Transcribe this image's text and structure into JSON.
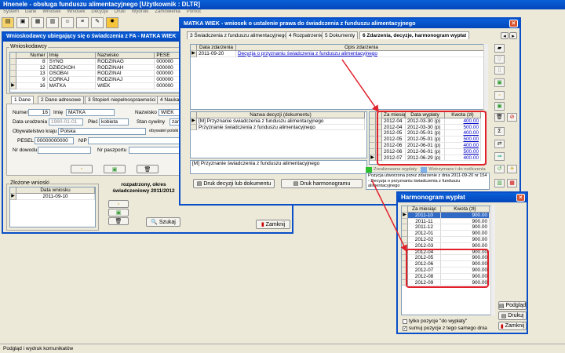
{
  "app": {
    "title": "Hnenele - obsługa funduszu alimentacyjnego [Użytkownik : DLTR]",
    "menu": [
      "System",
      "Dane",
      "Wniosek",
      "Wniosek",
      "Decyzje",
      "Druki",
      "Wydruki",
      "Zamówienia",
      "Pomoc"
    ],
    "statusbar": "Podgląd i wydruk komunikatów"
  },
  "mainwin": {
    "title": "Wnioskodawcy ubiegający się o świadczenia z FA - MATKA WIEK",
    "group_label": "Wnioskodawcy",
    "columns": [
      "Numer",
      "Imię",
      "Nazwisko",
      "PESE"
    ],
    "rows": [
      [
        "8",
        "SYNG",
        "RODZINAG",
        "000000"
      ],
      [
        "12",
        "DZIECKOH",
        "RODZINAH",
        "000000"
      ],
      [
        "13",
        "OSOBAI",
        "RODZINAI",
        "000000"
      ],
      [
        "9",
        "CORKAJ",
        "RODZINAJ",
        "000000"
      ],
      [
        "16",
        "MATKA",
        "WIEK",
        "000000"
      ]
    ],
    "tabs": [
      "1 Dane",
      "2 Dane adresowe",
      "3 Stopień niepełnosprawności",
      "4 Nauka"
    ],
    "fields": {
      "numer_label": "Numer",
      "numer": "16",
      "imie_label": "Imię",
      "imie": "MATKA",
      "nazwisko_label": "Nazwisko",
      "nazwisko": "WIEK",
      "data_ur_label": "Data urodzenia",
      "data_ur": "1980-01-01",
      "plec_label": "Płeć",
      "plec": "kobieta",
      "stan_label": "Stan cywilny",
      "stan": "zam",
      "obyw_label": "Obywatelstwo kraju",
      "obyw": "Polska",
      "obyw2_label": "obywatel polski",
      "pesel_label": "PESEL",
      "pesel": "00000000000",
      "nip_label": "NIP",
      "dowod_label": "Nr dowodu",
      "paszport_label": "Nr paszportu"
    },
    "wnioski_label": "Złożone wnioski",
    "wnioski_col": "Data wniosku",
    "wnioski_row": "2011-09-10",
    "okres_text": "rozpatrzony, okres świadczeniowy 2011/2012",
    "szukaj": "Szukaj",
    "zamknij": "Zamknij"
  },
  "decwin": {
    "title": "MATKA WIEK - wniosek o ustalenie prawa do świadczenia z funduszu alimentacyjnego",
    "tabs": [
      "3 Świadczenia z funduszu alimentacyjnego",
      "4 Rozpatrzenie",
      "5 Dokumenty",
      "6 Zdarzenia, decyzje, harmonogram wypłat"
    ],
    "zd_columns": [
      "Data zdarzenia",
      "Opis zdarzenia"
    ],
    "zd_row": [
      "2011-09-20",
      "Decyzja o przyznaniu świadczenia z funduszu alimentacyjnego"
    ],
    "dec_col": "Nazwa decyzji (dokumentu)",
    "dec_rows": [
      "[M] Przyznanie świadczenia z funduszu alimentacyjnego",
      "Przyznanie świadczenia z funduszu alimentacyjnego"
    ],
    "dec_bottom": "[M] Przyznanie świadczenia z funduszu alimentacyjnego",
    "btn_druk": "Druk decyzji lub dokumentu",
    "btn_harm": "Druk harmonogramu",
    "pay_columns": [
      "Za miesiąc",
      "Data wypłaty",
      "Kwota (zł)"
    ],
    "pay_rows": [
      [
        "2012-04",
        "2012-03-30 (p)",
        "400.00"
      ],
      [
        "2012-04",
        "2012-03-30 (p)",
        "500.00"
      ],
      [
        "2012-05",
        "2012-05-01 (p)",
        "400.00"
      ],
      [
        "2012-05",
        "2012-05-01 (p)",
        "500.00"
      ],
      [
        "2012-06",
        "2012-06-01 (p)",
        "400.00"
      ],
      [
        "2012-06",
        "2012-06-01 (p)",
        "500.00"
      ],
      [
        "2012-07",
        "2012-06-29 (p)",
        "400.00"
      ]
    ],
    "legend": "Zrealizowane wypłaty",
    "legend2": "Wstrzymane i do rozliczenia",
    "note": "Pozycja utworzona przez zdarzenie z dnia 2011-09-20 nr 154 - Decyzja o przyznaniu świadczenia z funduszu alimentacyjnego"
  },
  "harmwin": {
    "title": "Harmonogram wypłat",
    "columns": [
      "Za miesiąc",
      "Kwota (zł)"
    ],
    "rows": [
      [
        "2011-10",
        "900.00"
      ],
      [
        "2011-11",
        "900.00"
      ],
      [
        "2011-12",
        "900.00"
      ],
      [
        "2012-01",
        "900.00"
      ],
      [
        "2012-02",
        "900.00"
      ],
      [
        "2012-03",
        "900.00"
      ],
      [
        "2012-04",
        "900.00"
      ],
      [
        "2012-05",
        "900.00"
      ],
      [
        "2012-06",
        "900.00"
      ],
      [
        "2012-07",
        "900.00"
      ],
      [
        "2012-08",
        "900.00"
      ],
      [
        "2012-09",
        "900.00"
      ]
    ],
    "chk1": "tylko pozycje \"do wypłaty\"",
    "chk2": "sumuj pozycje z tego samego dnia",
    "podglad": "Podgląd",
    "drukuj": "Drukuj",
    "zamknij": "Zamknij"
  },
  "colors": {
    "title": "#0a4fc8",
    "highlight": "#e0202a",
    "select": "#316ac5"
  }
}
